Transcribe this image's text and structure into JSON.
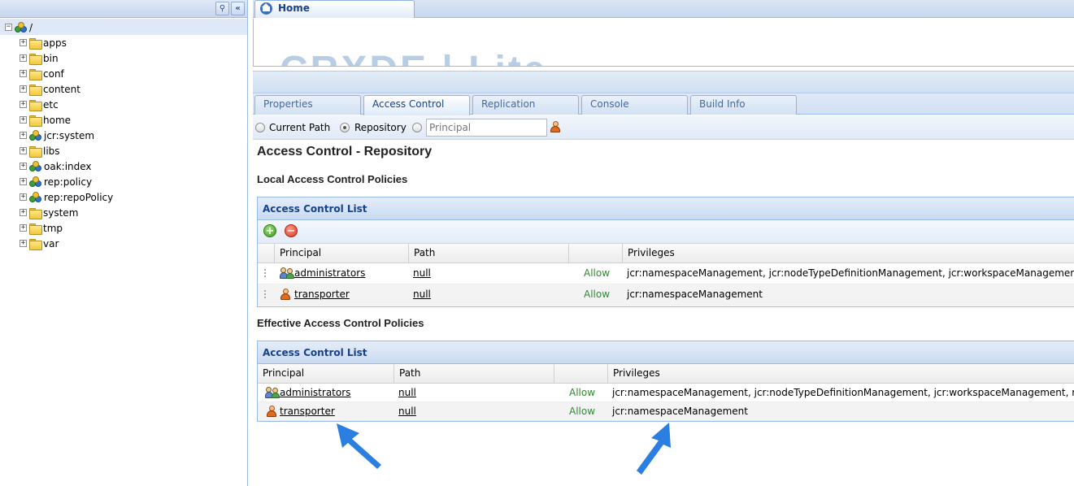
{
  "tree": {
    "root_label": "/",
    "items": [
      {
        "label": "apps",
        "icon": "folder"
      },
      {
        "label": "bin",
        "icon": "folder"
      },
      {
        "label": "conf",
        "icon": "folder"
      },
      {
        "label": "content",
        "icon": "folder"
      },
      {
        "label": "etc",
        "icon": "folder"
      },
      {
        "label": "home",
        "icon": "folder"
      },
      {
        "label": "jcr:system",
        "icon": "node"
      },
      {
        "label": "libs",
        "icon": "folder"
      },
      {
        "label": "oak:index",
        "icon": "node"
      },
      {
        "label": "rep:policy",
        "icon": "node"
      },
      {
        "label": "rep:repoPolicy",
        "icon": "node"
      },
      {
        "label": "system",
        "icon": "folder"
      },
      {
        "label": "tmp",
        "icon": "folder"
      },
      {
        "label": "var",
        "icon": "folder"
      }
    ]
  },
  "home_tab": {
    "label": "Home"
  },
  "banner": {
    "logo_text": "CRXDE | Lite"
  },
  "tabs": [
    "Properties",
    "Access Control",
    "Replication",
    "Console",
    "Build Info"
  ],
  "toolbar": {
    "radio_current_path": "Current Path",
    "radio_repository": "Repository",
    "principal_placeholder": "Principal",
    "selected": "Repository"
  },
  "page_title": "Access Control - Repository",
  "local": {
    "section_title": "Local Access Control Policies",
    "panel_title": "Access Control List",
    "columns": [
      "Principal",
      "Path",
      "",
      "Privileges"
    ],
    "rows": [
      {
        "principal": "administrators",
        "type": "group",
        "path": "null",
        "access": "Allow",
        "privileges": "jcr:namespaceManagement, jcr:nodeTypeDefinitionManagement, jcr:workspaceManagement, rep:privi"
      },
      {
        "principal": "transporter",
        "type": "user",
        "path": "null",
        "access": "Allow",
        "privileges": "jcr:namespaceManagement"
      }
    ]
  },
  "effective": {
    "section_title": "Effective Access Control Policies",
    "panel_title": "Access Control List",
    "columns": [
      "Principal",
      "Path",
      "",
      "Privileges"
    ],
    "rows": [
      {
        "principal": "administrators",
        "type": "group",
        "path": "null",
        "access": "Allow",
        "privileges": "jcr:namespaceManagement, jcr:nodeTypeDefinitionManagement, jcr:workspaceManagement, rep:privileg"
      },
      {
        "principal": "transporter",
        "type": "user",
        "path": "null",
        "access": "Allow",
        "privileges": "jcr:namespaceManagement"
      }
    ]
  },
  "colors": {
    "accent": "#15428b",
    "allow": "#2f8a2f",
    "annotation_arrow": "#2a7fe0"
  }
}
